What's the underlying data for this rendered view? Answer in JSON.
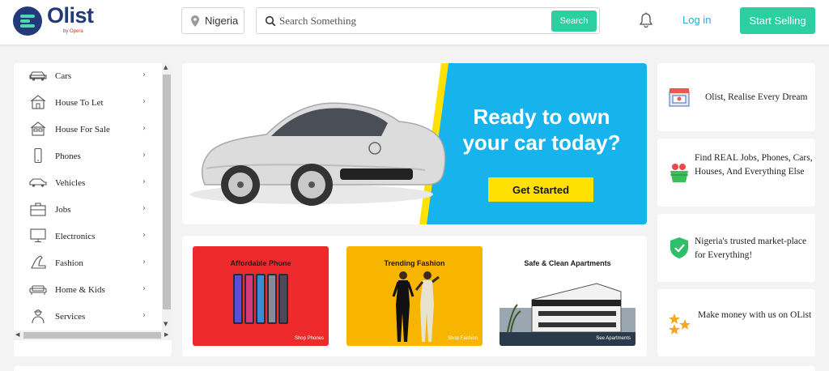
{
  "brand": {
    "name": "Olist",
    "sub_prefix": "by",
    "sub_brand": "Opera"
  },
  "header": {
    "location": "Nigeria",
    "search_placeholder": "Search Something",
    "search_button": "Search",
    "login": "Log in",
    "sell_button": "Start Selling"
  },
  "sidebar": {
    "items": [
      {
        "label": "Cars",
        "icon": "car-icon"
      },
      {
        "label": "House To Let",
        "icon": "house-icon"
      },
      {
        "label": "House For Sale",
        "icon": "house-sale-icon"
      },
      {
        "label": "Phones",
        "icon": "phone-icon"
      },
      {
        "label": "Vehicles",
        "icon": "vehicle-icon"
      },
      {
        "label": "Jobs",
        "icon": "briefcase-icon"
      },
      {
        "label": "Electronics",
        "icon": "monitor-icon"
      },
      {
        "label": "Fashion",
        "icon": "heel-icon"
      },
      {
        "label": "Home & Kids",
        "icon": "sofa-icon"
      },
      {
        "label": "Services",
        "icon": "worker-icon"
      }
    ]
  },
  "hero": {
    "title": "Ready to own your car today?",
    "button": "Get Started"
  },
  "promos": [
    {
      "title": "Affordable Phone",
      "link": "Shop Phones",
      "color": "#ee2a2d"
    },
    {
      "title": "Trending Fashion",
      "link": "Shop Fashion",
      "color": "#f7b500"
    },
    {
      "title": "Safe & Clean Apartments",
      "link": "See Apartments",
      "color": "#ffffff"
    }
  ],
  "features": [
    {
      "text": "Olist, Realise Every Dream",
      "icon": "storefront-icon"
    },
    {
      "text": "Find REAL Jobs, Phones, Cars, Houses, And Everything Else",
      "icon": "basket-icon"
    },
    {
      "text": "Nigeria's trusted market-place for Everything!",
      "icon": "shield-check-icon"
    },
    {
      "text": "Make money with us on OList",
      "icon": "stars-icon"
    }
  ],
  "colors": {
    "accent": "#2ccfa2",
    "brand": "#233a7a",
    "link": "#2ba9d9",
    "hero_blue": "#17b3ec",
    "hero_yellow": "#ffe100"
  }
}
